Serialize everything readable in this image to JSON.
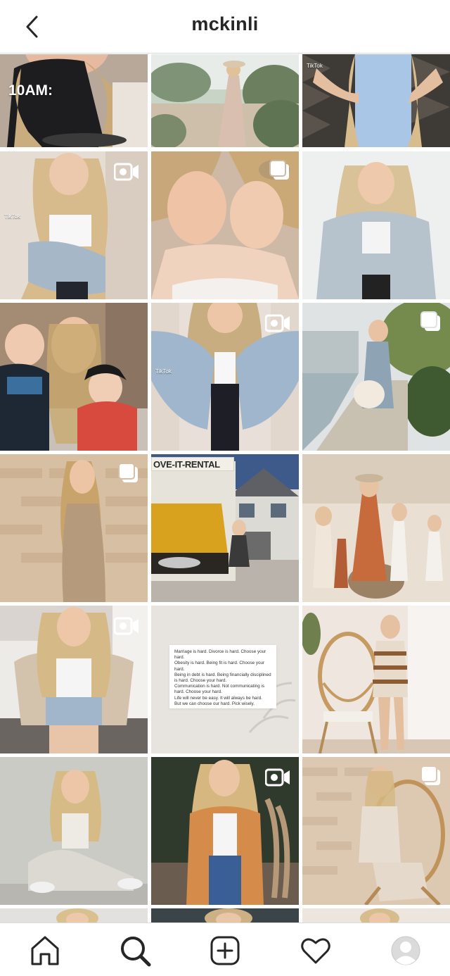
{
  "header": {
    "title": "mckinli",
    "back_icon": "chevron-left-icon"
  },
  "grid": {
    "posts": [
      {
        "overlay_text": "10AM:",
        "badge": "none"
      },
      {
        "badge": "none"
      },
      {
        "badge": "none",
        "tiktok": "TikTok"
      },
      {
        "badge": "video",
        "tiktok": "TikTok"
      },
      {
        "badge": "multiple"
      },
      {
        "badge": "none"
      },
      {
        "badge": "none"
      },
      {
        "badge": "video",
        "tiktok": "TikTok"
      },
      {
        "badge": "multiple"
      },
      {
        "badge": "multiple"
      },
      {
        "badge": "none",
        "sign_text": "OVE-IT-RENTAL"
      },
      {
        "badge": "none"
      },
      {
        "badge": "video"
      },
      {
        "badge": "none",
        "quote_lines": [
          "Marriage is hard. Divorce is hard. Choose your hard.",
          "Obesity is hard. Being fit is hard. Choose your hard.",
          "Being in debt is hard. Being financially disciplined is hard. Choose your hard.",
          "Communication is hard. Not communicating is hard. Choose your hard.",
          "Life will never be easy. It will always be hard.",
          "But we can choose our hard. Pick wisely."
        ]
      },
      {
        "badge": "none"
      },
      {
        "badge": "none"
      },
      {
        "badge": "video"
      },
      {
        "badge": "multiple"
      }
    ]
  },
  "bottom_nav": {
    "items": [
      "home-icon",
      "search-icon",
      "new-post-icon",
      "activity-heart-icon",
      "profile-avatar"
    ],
    "active": "search-icon"
  },
  "colors": {
    "text": "#262626",
    "divider": "#dbdbdb",
    "background": "#ffffff"
  }
}
